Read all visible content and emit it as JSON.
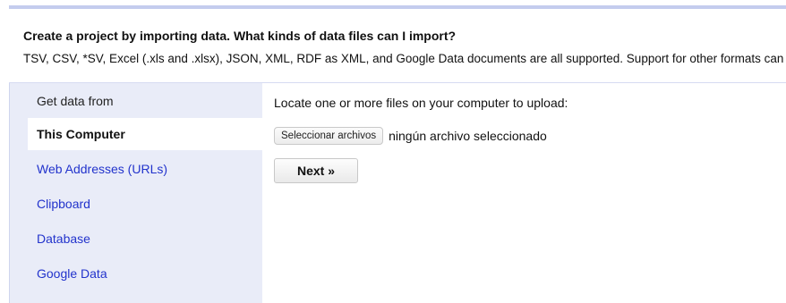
{
  "header": {
    "title": "Create a project by importing data. What kinds of data files can I import?",
    "description": "TSV, CSV, *SV, Excel (.xls and .xlsx), JSON, XML, RDF as XML, and Google Data documents are all supported. Support for other formats can be added with OpenRefine extensions."
  },
  "sidebar": {
    "heading": "Get data from",
    "items": [
      {
        "label": "This Computer",
        "selected": true
      },
      {
        "label": "Web Addresses (URLs)",
        "selected": false
      },
      {
        "label": "Clipboard",
        "selected": false
      },
      {
        "label": "Database",
        "selected": false
      },
      {
        "label": "Google Data",
        "selected": false
      }
    ]
  },
  "main": {
    "instruction": "Locate one or more files on your computer to upload:",
    "file_button_label": "Seleccionar archivos",
    "file_status": "ningún archivo seleccionado",
    "next_label": "Next »"
  },
  "colors": {
    "accent_border": "#c4ccee",
    "sidebar_bg": "#e9ecf8",
    "link": "#2233cc"
  }
}
